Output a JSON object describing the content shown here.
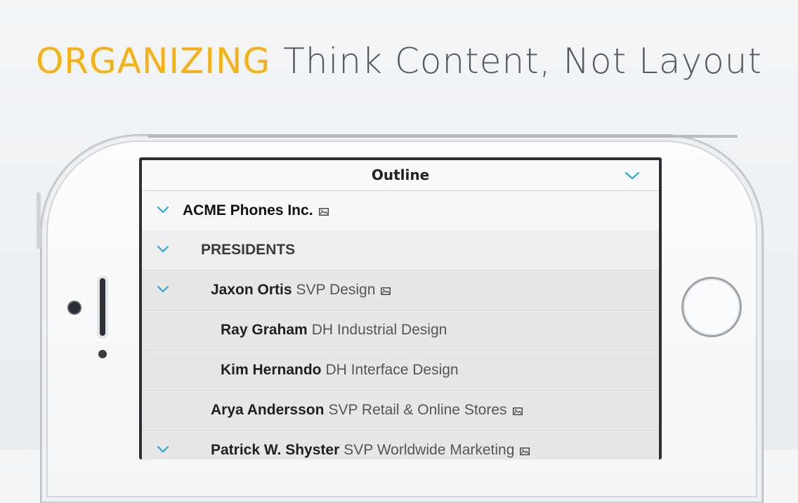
{
  "headline": {
    "keyword": "ORGANIZING",
    "tagline": "Think Content, Not Layout"
  },
  "app": {
    "nav_title": "Outline",
    "nav_icon": "chevron-down-icon",
    "accent_color": "#2ea8d6",
    "line_colors": {
      "teal": "#27a7a0",
      "green": "#4cb84a"
    }
  },
  "outline": [
    {
      "level": 0,
      "expanded": true,
      "name": "ACME Phones Inc.",
      "title": "",
      "has_image": true
    },
    {
      "level": 1,
      "expanded": true,
      "name": "PRESIDENTS",
      "title": "",
      "has_image": false
    },
    {
      "level": 2,
      "expanded": true,
      "name": "Jaxon Ortis",
      "title": "SVP Design",
      "has_image": true
    },
    {
      "level": 3,
      "expanded": false,
      "name": "Ray Graham",
      "title": "DH Industrial Design",
      "has_image": false
    },
    {
      "level": 3,
      "expanded": false,
      "name": "Kim Hernando",
      "title": "DH Interface Design",
      "has_image": false
    },
    {
      "level": 2,
      "expanded": false,
      "name": "Arya Andersson",
      "title": "SVP Retail & Online Stores",
      "has_image": true
    },
    {
      "level": 2,
      "expanded": true,
      "name": "Patrick W. Shyster",
      "title": "SVP Worldwide Marketing",
      "has_image": true
    }
  ]
}
